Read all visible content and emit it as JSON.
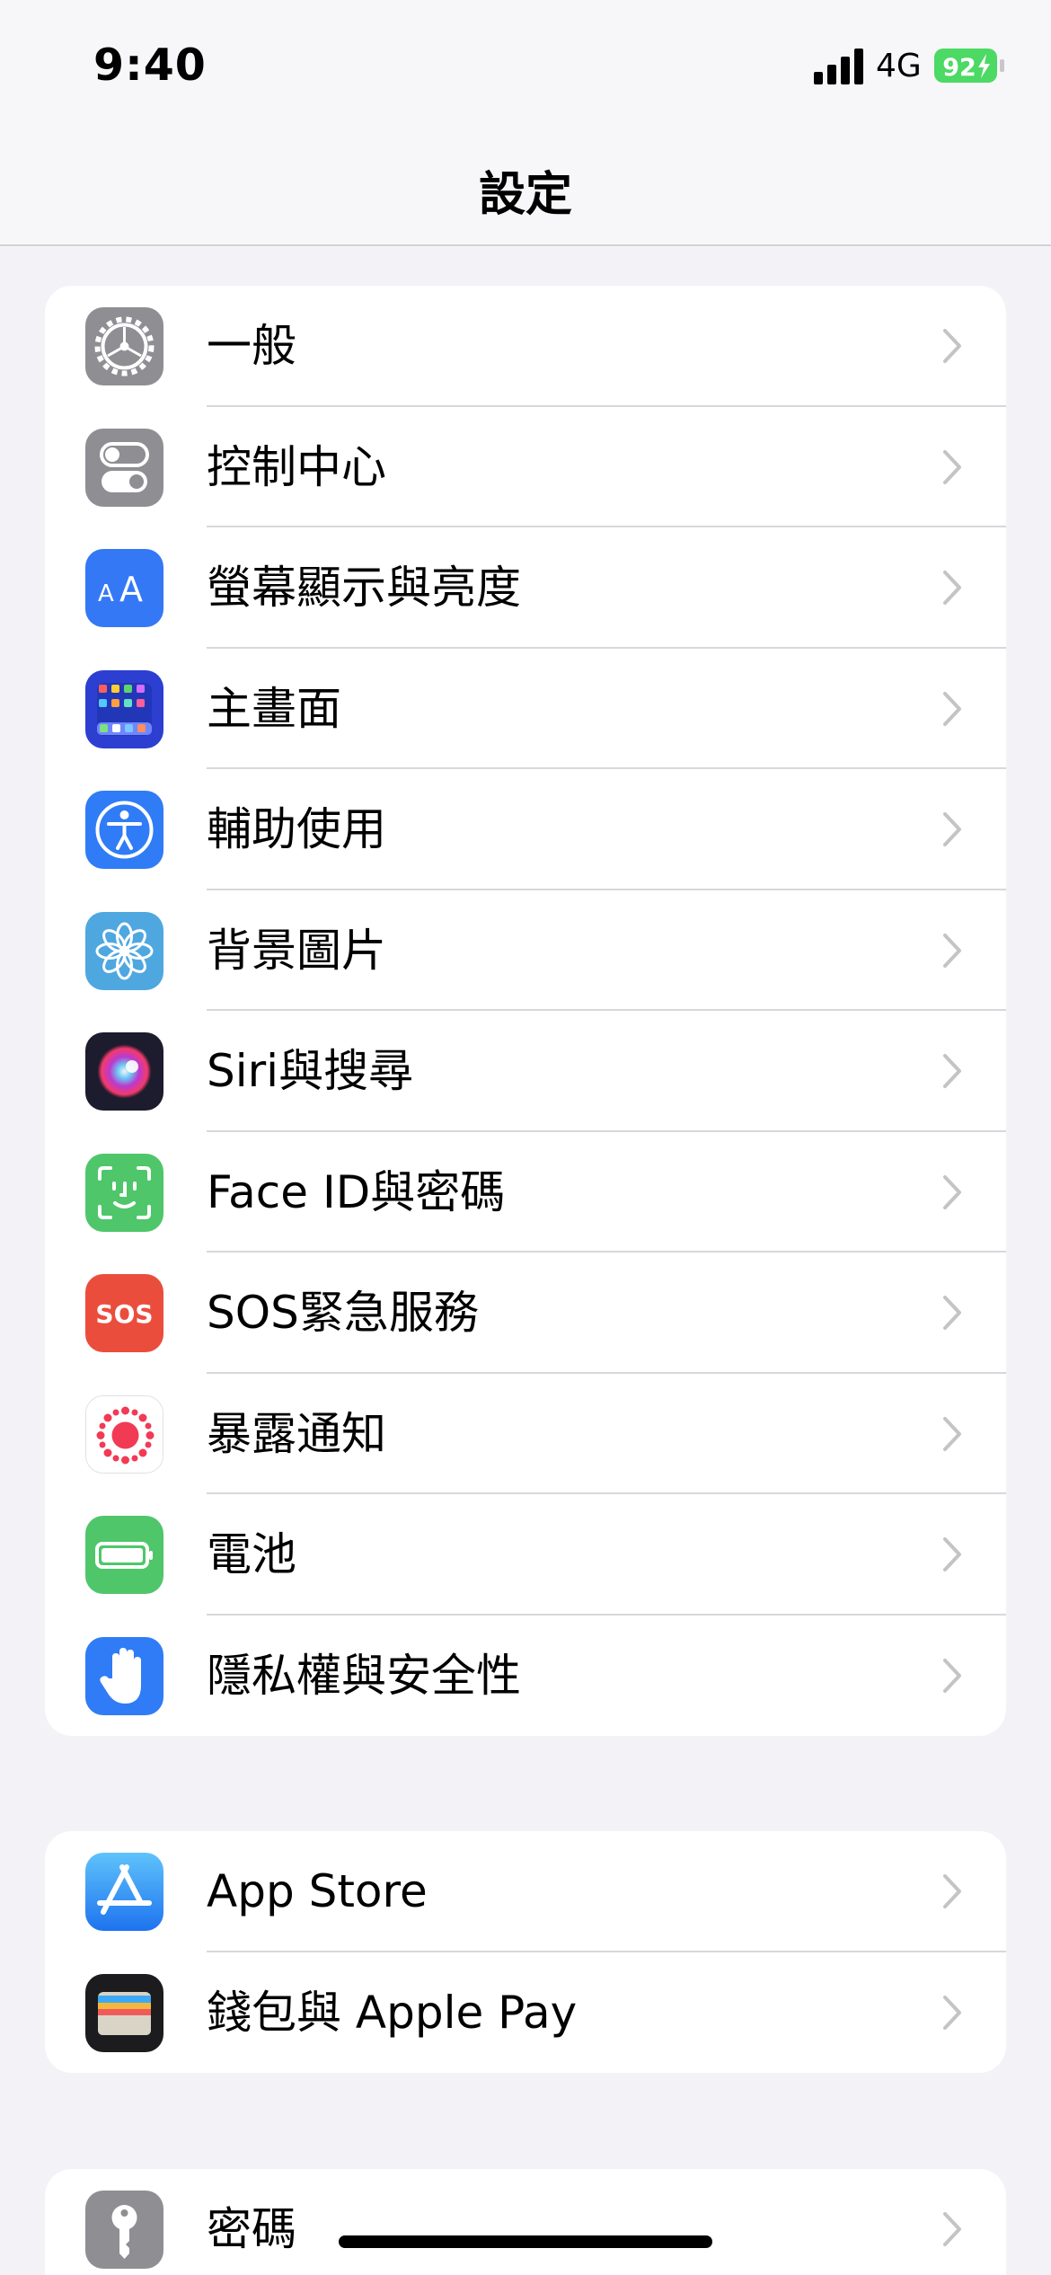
{
  "status_bar": {
    "time": "9:40",
    "network": "4G",
    "battery_percent": "92",
    "battery_color": "#4cd964"
  },
  "nav": {
    "title": "設定"
  },
  "groups": [
    {
      "items": [
        {
          "label": "一般",
          "icon": "gear-icon",
          "color": "#8e8e93"
        },
        {
          "label": "控制中心",
          "icon": "toggles-icon",
          "color": "#8e8e93"
        },
        {
          "label": "螢幕顯示與亮度",
          "icon": "text-size-icon",
          "color": "#3478f6"
        },
        {
          "label": "主畫面",
          "icon": "home-grid-icon",
          "color": "#2c3fd1"
        },
        {
          "label": "輔助使用",
          "icon": "accessibility-icon",
          "color": "#2f7cf6"
        },
        {
          "label": "背景圖片",
          "icon": "flower-icon",
          "color": "#4fa7e0"
        },
        {
          "label": "Siri與搜尋",
          "icon": "siri-icon",
          "color": "#1c1c2e"
        },
        {
          "label": "Face ID與密碼",
          "icon": "face-id-icon",
          "color": "#4fc66a"
        },
        {
          "label": "SOS緊急服務",
          "icon": "sos-icon",
          "color": "#eb4d3d"
        },
        {
          "label": "暴露通知",
          "icon": "exposure-icon",
          "color": "#ffffff"
        },
        {
          "label": "電池",
          "icon": "battery-icon",
          "color": "#4fc66a"
        },
        {
          "label": "隱私權與安全性",
          "icon": "hand-icon",
          "color": "#2f7cf6"
        }
      ]
    },
    {
      "items": [
        {
          "label": "App Store",
          "icon": "app-store-icon",
          "color": "#2f8ef7"
        },
        {
          "label": "錢包與 Apple Pay",
          "icon": "wallet-icon",
          "color": "#1c1c1e"
        }
      ]
    },
    {
      "items": [
        {
          "label": "密碼",
          "icon": "key-icon",
          "color": "#8e8e93"
        }
      ]
    }
  ]
}
